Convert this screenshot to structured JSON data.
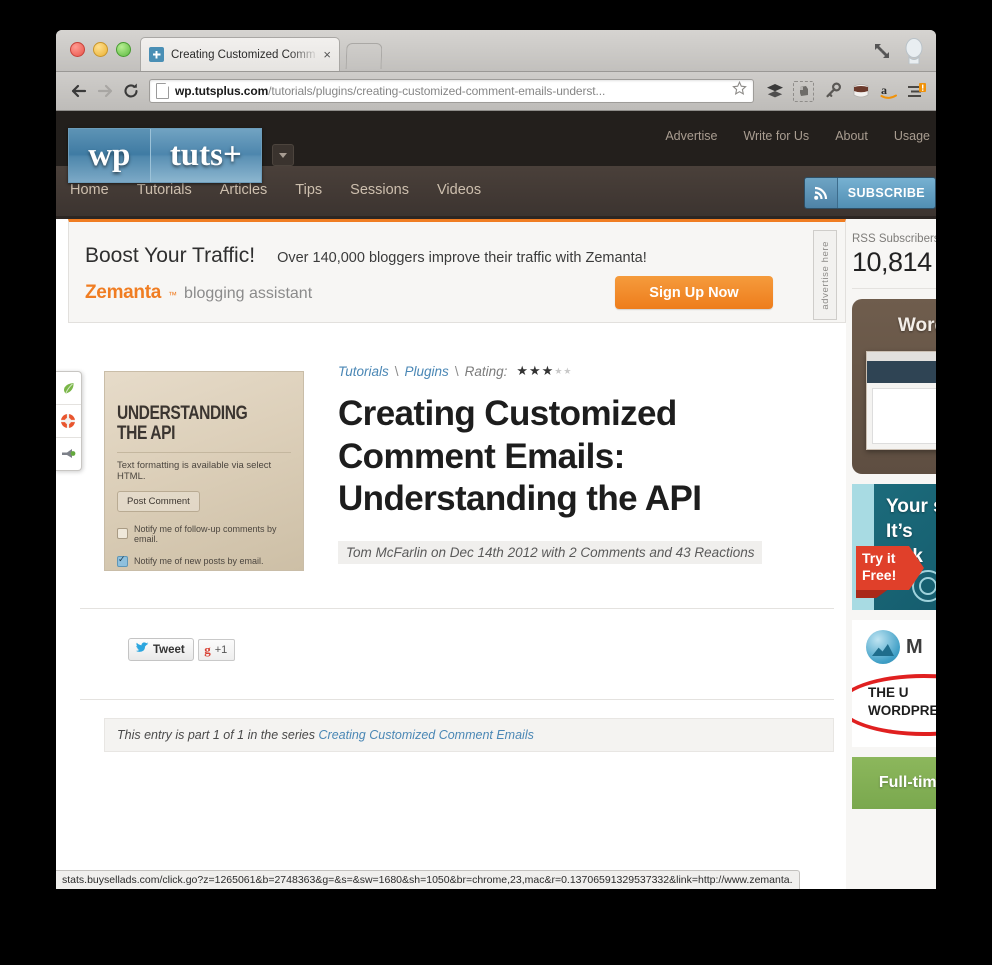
{
  "browser": {
    "tab": {
      "title": "Creating Customized Comm",
      "close_label": "×",
      "favicon_name": "wordpress-favicon"
    },
    "toolbar": {
      "back_label": "Back",
      "forward_label": "Forward",
      "reload_label": "Reload",
      "url_host": "wp.tutsplus.com",
      "url_path": "/tutorials/plugins/creating-customized-comment-emails-underst...",
      "url_full": "wp.tutsplus.com/tutorials/plugins/creating-customized-comment-emails-underst...",
      "extensions": [
        "buffer-layers-icon",
        "evernote-icon",
        "lastpass-key-icon",
        "robber-mask-icon",
        "amazon-icon",
        "menu-badge-icon"
      ]
    },
    "statusbar": {
      "url": "stats.buysellads.com/click.go?z=1265061&b=2748363&g=&s=&sw=1680&sh=1050&br=chrome,23,mac&r=0.13706591329537332&link=http://www.zemanta."
    }
  },
  "site": {
    "logo": {
      "part1": "wp",
      "part2": "tuts+"
    },
    "top_links": [
      "Advertise",
      "Write for Us",
      "About",
      "Usage"
    ],
    "nav": [
      "Home",
      "Tutorials",
      "Articles",
      "Tips",
      "Sessions",
      "Videos"
    ],
    "subscribe_label": "SUBSCRIBE"
  },
  "banner": {
    "title": "Boost Your Traffic!",
    "subtitle": "Over 140,000 bloggers improve their traffic with Zemanta!",
    "brand": "Zemanta",
    "brand_tm": "™",
    "tagline": "blogging assistant",
    "cta": "Sign Up Now",
    "advertise_here": "advertise here"
  },
  "float_toolbar": {
    "items": [
      "leaf-icon",
      "lifering-icon",
      "megaphone-icon"
    ]
  },
  "article": {
    "breadcrumb": {
      "cat1": "Tutorials",
      "cat2": "Plugins",
      "rating_label": "Rating:",
      "stars_filled": 3,
      "stars_total": 5
    },
    "title": "Creating Customized Comment Emails: Understanding the API",
    "byline": "Tom McFarlin on Dec 14th 2012 with 2 Comments and 43 Reactions",
    "thumbnail": {
      "title": "UNDERSTANDING THE API",
      "note": "Text formatting is available via select HTML.",
      "button": "Post Comment",
      "check1": "Notify me of follow-up comments by email.",
      "check2": "Notify me of new posts by email."
    },
    "social": {
      "tweet": "Tweet",
      "gplus": "+1",
      "gplus_g": "g"
    },
    "series": {
      "prefix": "This entry is part 1 of 1 in the series",
      "link": "Creating Customized Comment Emails"
    }
  },
  "sidebar": {
    "rss": {
      "label": "RSS Subscribers",
      "count": "10,814"
    },
    "ads": [
      {
        "name": "wordpress-ad",
        "title": "Word"
      },
      {
        "name": "teal-ad",
        "line1": "Your s",
        "line2": "It’s ",
        "line3": "Mak",
        "ribbon1": "Try it",
        "ribbon2": "Free!"
      },
      {
        "name": "white-ad",
        "brand": "M",
        "line1": "THE U",
        "line2": "WORDPRES"
      },
      {
        "name": "green-ad",
        "text": "Full-time, P"
      }
    ]
  },
  "colors": {
    "orange": "#f07d22",
    "blue": "#4a87b5",
    "dark": "#231f1c"
  }
}
